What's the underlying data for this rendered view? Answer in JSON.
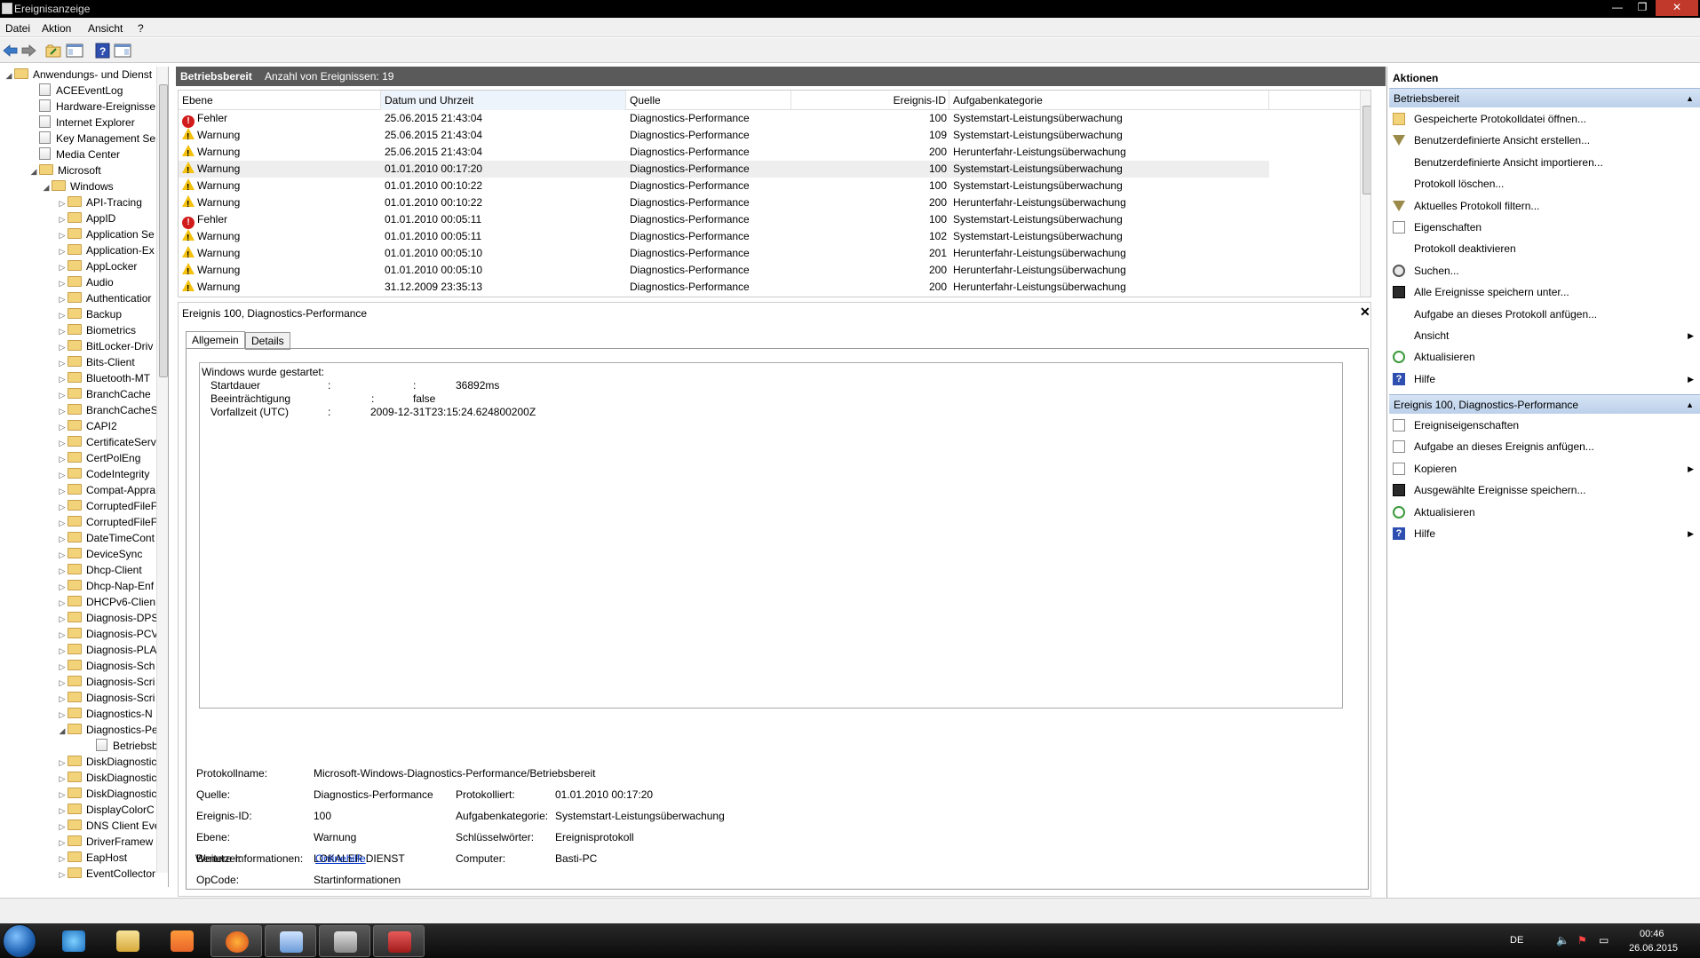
{
  "window": {
    "title": "Ereignisanzeige",
    "controls": [
      "—",
      "❐",
      "✕"
    ]
  },
  "menu": [
    "Datei",
    "Aktion",
    "Ansicht",
    "?"
  ],
  "tree": {
    "items": [
      {
        "label": "Anwendungs- und Dienst",
        "level": 0,
        "expander": "◢",
        "icon": "folder"
      },
      {
        "label": "ACEEventLog",
        "level": 1,
        "expander": "",
        "icon": "log"
      },
      {
        "label": "Hardware-Ereignisse",
        "level": 1,
        "expander": "",
        "icon": "log"
      },
      {
        "label": "Internet Explorer",
        "level": 1,
        "expander": "",
        "icon": "log"
      },
      {
        "label": "Key Management Ser",
        "level": 1,
        "expander": "",
        "icon": "log"
      },
      {
        "label": "Media Center",
        "level": 1,
        "expander": "",
        "icon": "log"
      },
      {
        "label": "Microsoft",
        "level": 1,
        "expander": "◢",
        "icon": "folder"
      },
      {
        "label": "Windows",
        "level": 2,
        "expander": "◢",
        "icon": "folder"
      },
      {
        "label": "API-Tracing",
        "level": 3,
        "expander": "▷",
        "icon": "folder"
      },
      {
        "label": "AppID",
        "level": 3,
        "expander": "▷",
        "icon": "folder"
      },
      {
        "label": "Application Se",
        "level": 3,
        "expander": "▷",
        "icon": "folder"
      },
      {
        "label": "Application-Ex",
        "level": 3,
        "expander": "▷",
        "icon": "folder"
      },
      {
        "label": "AppLocker",
        "level": 3,
        "expander": "▷",
        "icon": "folder"
      },
      {
        "label": "Audio",
        "level": 3,
        "expander": "▷",
        "icon": "folder"
      },
      {
        "label": "Authenticatior",
        "level": 3,
        "expander": "▷",
        "icon": "folder"
      },
      {
        "label": "Backup",
        "level": 3,
        "expander": "▷",
        "icon": "folder"
      },
      {
        "label": "Biometrics",
        "level": 3,
        "expander": "▷",
        "icon": "folder"
      },
      {
        "label": "BitLocker-Driv",
        "level": 3,
        "expander": "▷",
        "icon": "folder"
      },
      {
        "label": "Bits-Client",
        "level": 3,
        "expander": "▷",
        "icon": "folder"
      },
      {
        "label": "Bluetooth-MT",
        "level": 3,
        "expander": "▷",
        "icon": "folder"
      },
      {
        "label": "BranchCache",
        "level": 3,
        "expander": "▷",
        "icon": "folder"
      },
      {
        "label": "BranchCacheS",
        "level": 3,
        "expander": "▷",
        "icon": "folder"
      },
      {
        "label": "CAPI2",
        "level": 3,
        "expander": "▷",
        "icon": "folder"
      },
      {
        "label": "CertificateServ",
        "level": 3,
        "expander": "▷",
        "icon": "folder"
      },
      {
        "label": "CertPolEng",
        "level": 3,
        "expander": "▷",
        "icon": "folder"
      },
      {
        "label": "CodeIntegrity",
        "level": 3,
        "expander": "▷",
        "icon": "folder"
      },
      {
        "label": "Compat-Appra",
        "level": 3,
        "expander": "▷",
        "icon": "folder"
      },
      {
        "label": "CorruptedFileF",
        "level": 3,
        "expander": "▷",
        "icon": "folder"
      },
      {
        "label": "CorruptedFileF",
        "level": 3,
        "expander": "▷",
        "icon": "folder"
      },
      {
        "label": "DateTimeCont",
        "level": 3,
        "expander": "▷",
        "icon": "folder"
      },
      {
        "label": "DeviceSync",
        "level": 3,
        "expander": "▷",
        "icon": "folder"
      },
      {
        "label": "Dhcp-Client",
        "level": 3,
        "expander": "▷",
        "icon": "folder"
      },
      {
        "label": "Dhcp-Nap-Enf",
        "level": 3,
        "expander": "▷",
        "icon": "folder"
      },
      {
        "label": "DHCPv6-Clien",
        "level": 3,
        "expander": "▷",
        "icon": "folder"
      },
      {
        "label": "Diagnosis-DPS",
        "level": 3,
        "expander": "▷",
        "icon": "folder"
      },
      {
        "label": "Diagnosis-PCV",
        "level": 3,
        "expander": "▷",
        "icon": "folder"
      },
      {
        "label": "Diagnosis-PLA",
        "level": 3,
        "expander": "▷",
        "icon": "folder"
      },
      {
        "label": "Diagnosis-Sch",
        "level": 3,
        "expander": "▷",
        "icon": "folder"
      },
      {
        "label": "Diagnosis-Scri",
        "level": 3,
        "expander": "▷",
        "icon": "folder"
      },
      {
        "label": "Diagnosis-Scri",
        "level": 3,
        "expander": "▷",
        "icon": "folder"
      },
      {
        "label": "Diagnostics-N",
        "level": 3,
        "expander": "▷",
        "icon": "folder"
      },
      {
        "label": "Diagnostics-Pe",
        "level": 3,
        "expander": "◢",
        "icon": "folder"
      },
      {
        "label": "Betriebsber",
        "level": 4,
        "expander": "",
        "icon": "log"
      },
      {
        "label": "DiskDiagnostic",
        "level": 3,
        "expander": "▷",
        "icon": "folder"
      },
      {
        "label": "DiskDiagnostic",
        "level": 3,
        "expander": "▷",
        "icon": "folder"
      },
      {
        "label": "DiskDiagnostic",
        "level": 3,
        "expander": "▷",
        "icon": "folder"
      },
      {
        "label": "DisplayColorC",
        "level": 3,
        "expander": "▷",
        "icon": "folder"
      },
      {
        "label": "DNS Client Eve",
        "level": 3,
        "expander": "▷",
        "icon": "folder"
      },
      {
        "label": "DriverFramew",
        "level": 3,
        "expander": "▷",
        "icon": "folder"
      },
      {
        "label": "EapHost",
        "level": 3,
        "expander": "▷",
        "icon": "folder"
      },
      {
        "label": "EventCollector",
        "level": 3,
        "expander": "▷",
        "icon": "folder"
      }
    ],
    "scroll_h": "|||"
  },
  "center": {
    "log_name": "Betriebsbereit",
    "count_text": "Anzahl von Ereignissen: 19",
    "columns": [
      "Ebene",
      "Datum und Uhrzeit",
      "Quelle",
      "Ereignis-ID",
      "Aufgabenkategorie"
    ],
    "rows": [
      {
        "level": "Fehler",
        "type": "error",
        "date": "25.06.2015 21:43:04",
        "source": "Diagnostics-Performance",
        "id": "100",
        "category": "Systemstart-Leistungsüberwachung"
      },
      {
        "level": "Warnung",
        "type": "warn",
        "date": "25.06.2015 21:43:04",
        "source": "Diagnostics-Performance",
        "id": "109",
        "category": "Systemstart-Leistungsüberwachung"
      },
      {
        "level": "Warnung",
        "type": "warn",
        "date": "25.06.2015 21:43:04",
        "source": "Diagnostics-Performance",
        "id": "200",
        "category": "Herunterfahr-Leistungsüberwachung"
      },
      {
        "level": "Warnung",
        "type": "warn",
        "date": "01.01.2010 00:17:20",
        "source": "Diagnostics-Performance",
        "id": "100",
        "category": "Systemstart-Leistungsüberwachung",
        "selected": true
      },
      {
        "level": "Warnung",
        "type": "warn",
        "date": "01.01.2010 00:10:22",
        "source": "Diagnostics-Performance",
        "id": "100",
        "category": "Systemstart-Leistungsüberwachung"
      },
      {
        "level": "Warnung",
        "type": "warn",
        "date": "01.01.2010 00:10:22",
        "source": "Diagnostics-Performance",
        "id": "200",
        "category": "Herunterfahr-Leistungsüberwachung"
      },
      {
        "level": "Fehler",
        "type": "error",
        "date": "01.01.2010 00:05:11",
        "source": "Diagnostics-Performance",
        "id": "100",
        "category": "Systemstart-Leistungsüberwachung"
      },
      {
        "level": "Warnung",
        "type": "warn",
        "date": "01.01.2010 00:05:11",
        "source": "Diagnostics-Performance",
        "id": "102",
        "category": "Systemstart-Leistungsüberwachung"
      },
      {
        "level": "Warnung",
        "type": "warn",
        "date": "01.01.2010 00:05:10",
        "source": "Diagnostics-Performance",
        "id": "201",
        "category": "Herunterfahr-Leistungsüberwachung"
      },
      {
        "level": "Warnung",
        "type": "warn",
        "date": "01.01.2010 00:05:10",
        "source": "Diagnostics-Performance",
        "id": "200",
        "category": "Herunterfahr-Leistungsüberwachung"
      },
      {
        "level": "Warnung",
        "type": "warn",
        "date": "31.12.2009 23:35:13",
        "source": "Diagnostics-Performance",
        "id": "200",
        "category": "Herunterfahr-Leistungsüberwachung"
      }
    ]
  },
  "detail": {
    "header": "Ereignis 100, Diagnostics-Performance",
    "close": "✕",
    "tabs": [
      "Allgemein",
      "Details"
    ],
    "description": {
      "line1": "Windows wurde gestartet:",
      "items": [
        {
          "k": "Startdauer",
          "sep": ":",
          "v": "36892ms"
        },
        {
          "k": "Beeinträchtigung",
          "sep": ":",
          "v": "false"
        },
        {
          "k": "Vorfallzeit (UTC)",
          "sep": ":",
          "v": "2009-12-31T23:15:24.624800200Z"
        }
      ]
    },
    "props": {
      "protokollname_l": "Protokollname:",
      "protokollname_v": "Microsoft-Windows-Diagnostics-Performance/Betriebsbereit",
      "quelle_l": "Quelle:",
      "quelle_v": "Diagnostics-Performance",
      "protokolliert_l": "Protokolliert:",
      "protokolliert_v": "01.01.2010 00:17:20",
      "id_l": "Ereignis-ID:",
      "id_v": "100",
      "aufgabe_l": "Aufgabenkategorie:",
      "aufgabe_v": "Systemstart-Leistungsüberwachung",
      "ebene_l": "Ebene:",
      "ebene_v": "Warnung",
      "schluessel_l": "Schlüsselwörter:",
      "schluessel_v": "Ereignisprotokoll",
      "benutzer_l": "Benutzer:",
      "benutzer_v": "LOKALER DIENST",
      "computer_l": "Computer:",
      "computer_v": "Basti-PC",
      "opcode_l": "OpCode:",
      "opcode_v": "Startinformationen",
      "info_l": "Weitere Informationen:",
      "info_v": "Onlinehilfe"
    }
  },
  "actions": {
    "title": "Aktionen",
    "section1": "Betriebsbereit",
    "items1": [
      {
        "label": "Gespeicherte Protokolldatei öffnen...",
        "icon": "fold",
        "sub": false
      },
      {
        "label": "Benutzerdefinierte Ansicht erstellen...",
        "icon": "filter",
        "sub": false
      },
      {
        "label": "Benutzerdefinierte Ansicht importieren...",
        "icon": "none",
        "sub": false
      },
      {
        "label": "Protokoll löschen...",
        "icon": "none",
        "sub": false
      },
      {
        "label": "Aktuelles Protokoll filtern...",
        "icon": "filter",
        "sub": false
      },
      {
        "label": "Eigenschaften",
        "icon": "doc",
        "sub": false
      },
      {
        "label": "Protokoll deaktivieren",
        "icon": "none",
        "sub": false
      },
      {
        "label": "Suchen...",
        "icon": "search",
        "sub": false
      },
      {
        "label": "Alle Ereignisse speichern unter...",
        "icon": "save",
        "sub": false
      },
      {
        "label": "Aufgabe an dieses Protokoll anfügen...",
        "icon": "none",
        "sub": false
      },
      {
        "label": "Ansicht",
        "icon": "none",
        "sub": true
      },
      {
        "label": "Aktualisieren",
        "icon": "refresh",
        "sub": false
      },
      {
        "label": "Hilfe",
        "icon": "help",
        "sub": true
      }
    ],
    "section2": "Ereignis 100, Diagnostics-Performance",
    "items2": [
      {
        "label": "Ereigniseigenschaften",
        "icon": "doc",
        "sub": false
      },
      {
        "label": "Aufgabe an dieses Ereignis anfügen...",
        "icon": "doc",
        "sub": false
      },
      {
        "label": "Kopieren",
        "icon": "doc",
        "sub": true
      },
      {
        "label": "Ausgewählte Ereignisse speichern...",
        "icon": "save",
        "sub": false
      },
      {
        "label": "Aktualisieren",
        "icon": "refresh",
        "sub": false
      },
      {
        "label": "Hilfe",
        "icon": "help",
        "sub": true
      }
    ]
  },
  "taskbar": {
    "apps": [
      "ie",
      "explorer",
      "media",
      "firefox",
      "control",
      "drive",
      "toolbox"
    ],
    "lang": "DE",
    "time": "00:46",
    "date": "26.06.2015"
  },
  "colors": {
    "header_bg": "#5a5a5a",
    "section_bg": "#c6d8ee",
    "link": "#0033cc",
    "error": "#d21b1b",
    "warning": "#f4c10e"
  }
}
